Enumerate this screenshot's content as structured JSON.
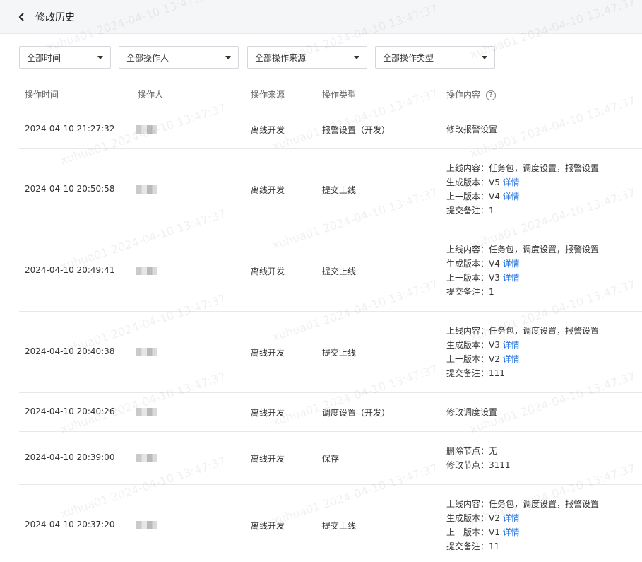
{
  "header": {
    "title": "修改历史"
  },
  "filters": [
    {
      "label": "全部时间"
    },
    {
      "label": "全部操作人"
    },
    {
      "label": "全部操作来源"
    },
    {
      "label": "全部操作类型"
    }
  ],
  "columns": {
    "time": "操作时间",
    "operator": "操作人",
    "source": "操作来源",
    "type": "操作类型",
    "content": "操作内容",
    "help": "?"
  },
  "rows": [
    {
      "time": "2024-04-10 21:27:32",
      "source": "离线开发",
      "type": "报警设置（开发）",
      "content": [
        {
          "text": "修改报警设置"
        }
      ]
    },
    {
      "time": "2024-04-10 20:50:58",
      "source": "离线开发",
      "type": "提交上线",
      "content": [
        {
          "text": "上线内容：任务包，调度设置，报警设置"
        },
        {
          "text": "生成版本：V5 ",
          "link": "详情"
        },
        {
          "text": "上一版本：V4 ",
          "link": "详情"
        },
        {
          "text": "提交备注：1"
        }
      ]
    },
    {
      "time": "2024-04-10 20:49:41",
      "source": "离线开发",
      "type": "提交上线",
      "content": [
        {
          "text": "上线内容：任务包，调度设置，报警设置"
        },
        {
          "text": "生成版本：V4 ",
          "link": "详情"
        },
        {
          "text": "上一版本：V3 ",
          "link": "详情"
        },
        {
          "text": "提交备注：1"
        }
      ]
    },
    {
      "time": "2024-04-10 20:40:38",
      "source": "离线开发",
      "type": "提交上线",
      "content": [
        {
          "text": "上线内容：任务包，调度设置，报警设置"
        },
        {
          "text": "生成版本：V3 ",
          "link": "详情"
        },
        {
          "text": "上一版本：V2 ",
          "link": "详情"
        },
        {
          "text": "提交备注：111"
        }
      ]
    },
    {
      "time": "2024-04-10 20:40:26",
      "source": "离线开发",
      "type": "调度设置（开发）",
      "content": [
        {
          "text": "修改调度设置"
        }
      ]
    },
    {
      "time": "2024-04-10 20:39:00",
      "source": "离线开发",
      "type": "保存",
      "content": [
        {
          "text": "删除节点：无"
        },
        {
          "text": "修改节点：3111"
        }
      ]
    },
    {
      "time": "2024-04-10 20:37:20",
      "source": "离线开发",
      "type": "提交上线",
      "content": [
        {
          "text": "上线内容：任务包，调度设置，报警设置"
        },
        {
          "text": "生成版本：V2 ",
          "link": "详情"
        },
        {
          "text": "上一版本：V1 ",
          "link": "详情"
        },
        {
          "text": "提交备注：11"
        }
      ]
    }
  ],
  "watermark": "xuhua01 2024-04-10 13:47:37"
}
